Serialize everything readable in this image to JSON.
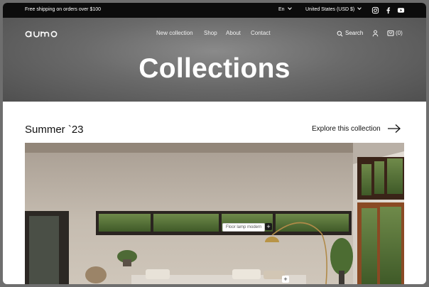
{
  "announcement": {
    "message": "Free shipping on orders over $100",
    "language": "En",
    "country": "United States (USD $)"
  },
  "social": [
    "instagram-icon",
    "facebook-icon",
    "youtube-icon"
  ],
  "header": {
    "logo": "aumo",
    "nav": [
      "New collection",
      "Shop",
      "About",
      "Contact"
    ],
    "search_label": "Search",
    "cart_count": "(0)"
  },
  "hero": {
    "title": "Collections"
  },
  "collection": {
    "title": "Summer `23",
    "explore_label": "Explore this collection",
    "hotspot_label": "Floor lamp modern",
    "hotspot_plus": "+"
  }
}
